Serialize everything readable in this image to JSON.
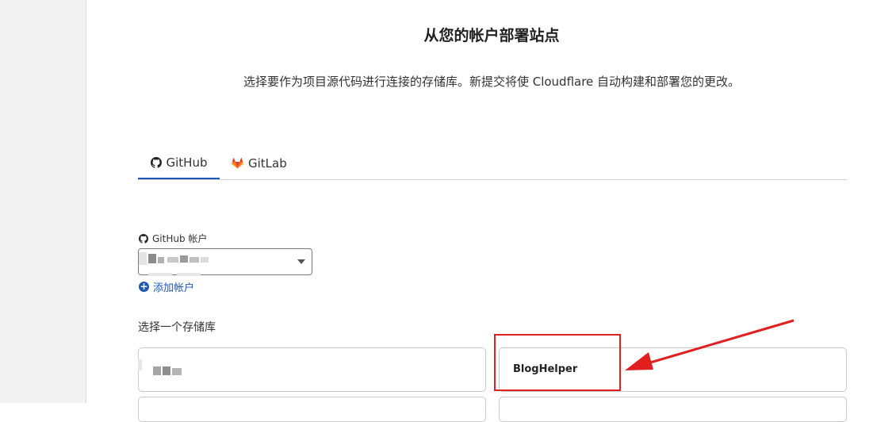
{
  "header": {
    "title": "从您的帐户部署站点",
    "subtitle": "选择要作为项目源代码进行连接的存储库。新提交将使 Cloudflare 自动构建和部署您的更改。"
  },
  "tabs": [
    {
      "label": "GitHub",
      "icon": "github-icon",
      "active": true
    },
    {
      "label": "GitLab",
      "icon": "gitlab-icon",
      "active": false
    }
  ],
  "account": {
    "label": "GitHub 帐户",
    "add_label": "添加帐户"
  },
  "repos": {
    "label": "选择一个存储库",
    "items": [
      {
        "name": ""
      },
      {
        "name": "BlogHelper"
      }
    ]
  },
  "colors": {
    "accent": "#1d58b6",
    "annotation": "#e02020"
  }
}
